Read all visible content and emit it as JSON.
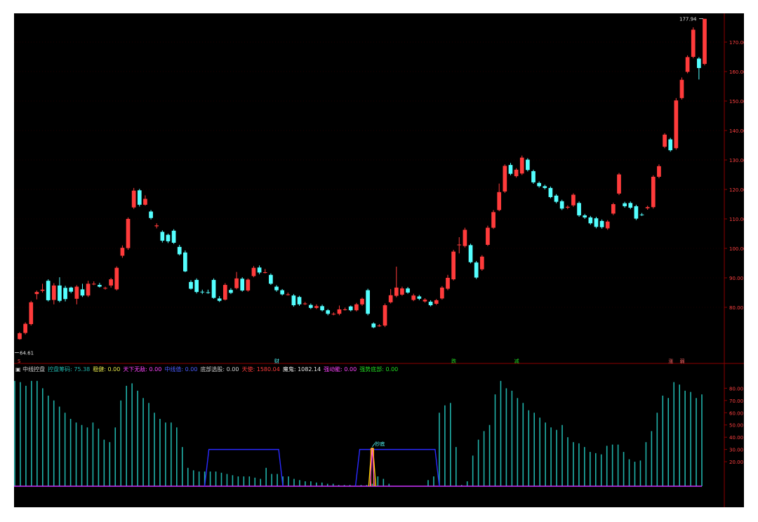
{
  "chart_data": [
    {
      "type": "candlestick",
      "title": "",
      "ylim": [
        54,
        180
      ],
      "yticks": [
        80,
        90,
        100,
        110,
        120,
        130,
        140,
        150,
        160,
        170
      ],
      "ytick_labels": [
        "80.00",
        "90.00",
        "100.00",
        "110.00",
        "120.00",
        "130.00",
        "140.00",
        "150.00",
        "160.00",
        "170.00"
      ],
      "high_label": "177.94",
      "low_label": "64.61",
      "up_color": "#ff3b3b",
      "down_color": "#54ffff",
      "candles": [
        [
          69.2,
          71.2,
          69.0,
          71.6
        ],
        [
          71.3,
          74.4,
          70.8,
          74.9
        ],
        [
          74.3,
          81.7,
          73.8,
          82.2
        ],
        [
          84.5,
          85.2,
          82.7,
          85.7
        ],
        [
          85.6,
          86.0,
          85.0,
          88.0
        ],
        [
          89.0,
          82.4,
          82.0,
          89.5
        ],
        [
          82.5,
          87.4,
          81.0,
          88.2
        ],
        [
          87.4,
          82.2,
          81.7,
          90.2
        ],
        [
          86.6,
          82.8,
          82.0,
          87.3
        ],
        [
          86.7,
          85.3,
          84.8,
          87.0
        ],
        [
          82.9,
          87.0,
          81.0,
          87.5
        ],
        [
          86.1,
          84.0,
          83.5,
          88.0
        ],
        [
          84.0,
          88.0,
          83.5,
          89.0
        ],
        [
          88.0,
          88.0,
          87.5,
          88.8
        ],
        [
          87.6,
          87.0,
          86.7,
          88.3
        ],
        [
          86.5,
          86.6,
          86.0,
          87.0
        ],
        [
          87.4,
          89.5,
          86.7,
          90.0
        ],
        [
          86.1,
          93.4,
          85.7,
          93.9
        ],
        [
          97.5,
          100.2,
          96.8,
          101.0
        ],
        [
          100.1,
          110.0,
          99.5,
          110.5
        ],
        [
          113.9,
          119.6,
          113.4,
          120.5
        ],
        [
          119.7,
          114.8,
          114.2,
          120.2
        ],
        [
          114.8,
          116.8,
          114.5,
          118.0
        ],
        [
          112.5,
          110.3,
          109.8,
          113.0
        ],
        [
          107.5,
          107.8,
          106.8,
          108.5
        ],
        [
          105.6,
          102.6,
          102.0,
          106.1
        ],
        [
          104.6,
          102.4,
          101.8,
          105.0
        ],
        [
          106.0,
          101.9,
          101.5,
          106.5
        ],
        [
          100.5,
          98.0,
          97.6,
          101.2
        ],
        [
          98.6,
          92.2,
          91.9,
          99.3
        ],
        [
          88.6,
          86.3,
          86.0,
          89.2
        ],
        [
          89.3,
          85.2,
          84.7,
          89.8
        ],
        [
          85.3,
          85.1,
          84.5,
          86.0
        ],
        [
          85.1,
          85.0,
          84.6,
          86.0
        ],
        [
          89.3,
          83.2,
          82.9,
          89.8
        ],
        [
          83.0,
          82.2,
          81.8,
          83.8
        ],
        [
          82.6,
          87.6,
          82.3,
          88.2
        ],
        [
          85.9,
          84.9,
          84.5,
          86.5
        ],
        [
          86.5,
          89.8,
          86.1,
          92.0
        ],
        [
          89.7,
          85.7,
          85.3,
          90.2
        ],
        [
          85.7,
          89.4,
          85.3,
          89.8
        ],
        [
          90.6,
          93.4,
          90.2,
          94.0
        ],
        [
          93.5,
          91.8,
          91.2,
          94.2
        ],
        [
          91.9,
          91.9,
          91.5,
          93.0
        ],
        [
          91.0,
          88.0,
          87.6,
          91.5
        ],
        [
          87.0,
          85.8,
          85.3,
          87.5
        ],
        [
          85.8,
          84.4,
          84.0,
          86.2
        ],
        [
          84.4,
          84.4,
          84.0,
          85.0
        ],
        [
          84.0,
          80.7,
          80.2,
          84.5
        ],
        [
          83.5,
          81.0,
          80.5,
          83.9
        ],
        [
          81.3,
          81.3,
          80.8,
          81.8
        ],
        [
          80.8,
          79.8,
          79.4,
          81.3
        ],
        [
          79.8,
          80.4,
          79.4,
          81.0
        ],
        [
          80.4,
          79.0,
          78.6,
          80.9
        ],
        [
          79.0,
          77.8,
          77.3,
          79.4
        ],
        [
          77.8,
          77.8,
          77.3,
          78.3
        ],
        [
          77.8,
          79.3,
          77.3,
          80.6
        ],
        [
          79.3,
          79.3,
          78.9,
          79.9
        ],
        [
          80.3,
          79.0,
          78.6,
          80.6
        ],
        [
          79.0,
          81.0,
          78.6,
          81.5
        ],
        [
          81.0,
          82.9,
          80.5,
          83.3
        ],
        [
          85.8,
          77.8,
          77.3,
          86.3
        ],
        [
          74.5,
          73.2,
          72.9,
          74.9
        ],
        [
          73.8,
          73.8,
          73.4,
          74.3
        ],
        [
          73.8,
          80.7,
          73.3,
          81.3
        ],
        [
          81.7,
          84.1,
          81.3,
          86.2
        ],
        [
          83.9,
          86.7,
          83.4,
          93.8
        ],
        [
          84.3,
          86.4,
          83.9,
          87.0
        ],
        [
          86.4,
          85.0,
          84.6,
          86.9
        ],
        [
          82.5,
          84.0,
          82.1,
          84.6
        ],
        [
          83.7,
          82.9,
          82.4,
          84.2
        ],
        [
          82.0,
          82.6,
          81.6,
          83.1
        ],
        [
          81.9,
          80.7,
          80.3,
          82.4
        ],
        [
          81.2,
          82.4,
          80.8,
          82.8
        ],
        [
          83.0,
          86.7,
          82.6,
          87.2
        ],
        [
          86.3,
          90.0,
          85.8,
          91.0
        ],
        [
          89.5,
          98.9,
          89.1,
          99.5
        ],
        [
          101.3,
          101.3,
          98.3,
          103.8
        ],
        [
          100.8,
          106.3,
          100.3,
          107.0
        ],
        [
          101.1,
          95.3,
          94.9,
          101.6
        ],
        [
          95.2,
          90.1,
          89.6,
          95.7
        ],
        [
          92.9,
          97.2,
          92.4,
          97.7
        ],
        [
          101.2,
          107.0,
          100.8,
          107.7
        ],
        [
          107.0,
          112.3,
          106.6,
          113.0
        ],
        [
          113.0,
          119.1,
          112.6,
          122.0
        ],
        [
          119.3,
          128.0,
          118.8,
          128.5
        ],
        [
          128.3,
          125.3,
          124.8,
          129.0
        ],
        [
          124.5,
          126.7,
          124.0,
          127.2
        ],
        [
          125.4,
          130.8,
          124.9,
          131.5
        ],
        [
          130.1,
          126.6,
          126.1,
          130.6
        ],
        [
          126.2,
          122.4,
          121.9,
          126.7
        ],
        [
          122.2,
          121.1,
          120.6,
          122.7
        ],
        [
          121.1,
          120.5,
          120.0,
          121.6
        ],
        [
          120.5,
          117.4,
          117.0,
          121.0
        ],
        [
          117.9,
          115.8,
          115.3,
          118.4
        ],
        [
          116.0,
          113.5,
          113.0,
          116.5
        ],
        [
          113.8,
          114.1,
          113.3,
          114.6
        ],
        [
          114.6,
          118.2,
          114.1,
          118.7
        ],
        [
          115.4,
          111.2,
          110.7,
          115.9
        ],
        [
          111.2,
          110.5,
          110.0,
          111.7
        ],
        [
          110.5,
          108.5,
          108.0,
          111.0
        ],
        [
          110.2,
          107.3,
          106.8,
          110.7
        ],
        [
          109.3,
          107.2,
          106.7,
          109.8
        ],
        [
          106.8,
          109.1,
          106.3,
          109.6
        ],
        [
          111.8,
          115.0,
          111.3,
          115.5
        ],
        [
          118.6,
          125.1,
          118.1,
          125.6
        ],
        [
          115.3,
          114.3,
          113.8,
          115.8
        ],
        [
          115.4,
          113.8,
          113.3,
          115.9
        ],
        [
          114.3,
          110.1,
          109.6,
          114.8
        ],
        [
          111.5,
          111.4,
          111.0,
          112.0
        ],
        [
          113.6,
          114.0,
          113.1,
          114.5
        ],
        [
          114.0,
          124.3,
          113.5,
          124.8
        ],
        [
          124.3,
          127.9,
          123.8,
          128.5
        ],
        [
          134.5,
          138.6,
          134.0,
          139.1
        ],
        [
          137.0,
          133.3,
          132.8,
          137.5
        ],
        [
          134.0,
          150.2,
          133.5,
          151.0
        ],
        [
          151.0,
          157.2,
          150.5,
          158.0
        ],
        [
          159.9,
          164.9,
          159.4,
          165.5
        ],
        [
          165.0,
          174.2,
          164.5,
          175.0
        ],
        [
          164.4,
          161.2,
          157.3,
          164.9
        ],
        [
          162.6,
          177.9,
          162.1,
          177.9
        ]
      ],
      "markers": [
        {
          "index": 0,
          "label": "S",
          "color": "#ff3b3b"
        },
        {
          "index": 45,
          "label": "财",
          "color": "#54ffff"
        },
        {
          "index": 76,
          "label": "跌",
          "color": "#22dd22"
        },
        {
          "index": 87,
          "label": "减",
          "color": "#22dd22"
        },
        {
          "index": 114,
          "label": "涨",
          "color": "#ff6666"
        },
        {
          "index": 116,
          "label": "弱",
          "color": "#ff6666"
        }
      ]
    },
    {
      "type": "bar",
      "title": "",
      "ylim": [
        0,
        88
      ],
      "yticks": [
        20,
        30,
        40,
        50,
        60,
        70,
        80
      ],
      "ytick_labels": [
        "20.00",
        "30.00",
        "40.00",
        "50.00",
        "60.00",
        "70.00",
        "80.00"
      ],
      "series": [
        {
          "name": "控盘筹码",
          "color": "#20b2aa",
          "values": [
            86,
            85,
            82,
            86,
            86,
            80,
            74,
            70,
            65,
            60,
            55,
            52,
            50,
            48,
            52,
            47,
            38,
            36,
            48,
            70,
            82,
            84,
            78,
            72,
            68,
            60,
            55,
            52,
            52,
            48,
            32,
            15,
            13,
            12,
            12,
            12,
            12,
            11,
            10,
            9,
            8,
            8,
            8,
            7,
            6,
            15,
            10,
            10,
            8,
            8,
            6,
            5,
            4,
            4,
            3,
            3,
            2,
            2,
            1,
            1,
            1,
            1,
            1,
            1,
            1,
            1,
            1,
            1,
            1,
            1,
            1,
            1,
            1,
            1,
            1,
            1,
            1,
            1,
            1,
            1,
            1,
            1,
            1,
            1,
            1,
            1,
            1,
            1,
            1,
            1,
            1,
            1,
            1,
            1,
            1,
            1,
            1,
            1,
            1,
            1,
            1,
            1,
            1,
            1,
            1,
            1,
            1,
            1,
            1,
            1,
            1,
            1,
            1,
            1,
            1,
            1
          ]
        },
        {
          "name": "底部选股",
          "color": "#1a1aff",
          "values": [
            0,
            0,
            0,
            0,
            0,
            0,
            0,
            0,
            0,
            0,
            0,
            0,
            0,
            0,
            0,
            0,
            0,
            0,
            0,
            0,
            0,
            0,
            0,
            0,
            0,
            0,
            0,
            0,
            0,
            0,
            0,
            0,
            0,
            0,
            0,
            0,
            0,
            0,
            0,
            0,
            0,
            0,
            0,
            0,
            0,
            0,
            0,
            0,
            0,
            0,
            0,
            0,
            0,
            0,
            0,
            0,
            0,
            0,
            0,
            0,
            0,
            0,
            0,
            0,
            0,
            0,
            0,
            0,
            0,
            0,
            0,
            0,
            0,
            0,
            0,
            0,
            0,
            0,
            0,
            0,
            0,
            0,
            0,
            0,
            0,
            0,
            0,
            0,
            0,
            0,
            0,
            0,
            0,
            0,
            0,
            0,
            0,
            0,
            0,
            0,
            0,
            0,
            0,
            0,
            0,
            0,
            0,
            0,
            0,
            0,
            0,
            0,
            0,
            0,
            0,
            0
          ]
        }
      ],
      "bars": [
        86,
        85,
        82,
        86,
        86,
        80,
        74,
        70,
        65,
        60,
        55,
        52,
        50,
        48,
        52,
        47,
        38,
        36,
        48,
        70,
        82,
        84,
        78,
        72,
        68,
        60,
        55,
        52,
        52,
        48,
        32,
        15,
        13,
        12,
        12,
        12,
        12,
        11,
        10,
        9,
        8,
        8,
        8,
        7,
        6,
        15,
        10,
        10,
        8,
        8,
        6,
        5,
        4,
        4,
        3,
        3,
        2,
        2,
        1,
        1,
        1,
        1,
        1,
        1,
        2,
        8,
        6,
        2,
        0,
        0,
        0,
        0,
        0,
        0,
        5,
        8,
        60,
        66,
        68,
        32,
        1,
        4,
        25,
        38,
        45,
        50,
        75,
        86,
        80,
        78,
        72,
        68,
        62,
        60,
        56,
        52,
        48,
        46,
        50,
        40,
        36,
        35,
        32,
        28,
        27,
        26,
        33,
        34,
        34,
        28,
        22,
        20,
        21,
        36,
        45,
        60,
        74,
        72,
        85,
        83,
        78,
        77,
        72,
        75
      ],
      "band_a_high": 30,
      "band_segments": [
        [
          34,
          48
        ],
        [
          61,
          76
        ]
      ],
      "pulse_label": "抄底",
      "pulse_index": 64
    }
  ],
  "indicator_legend": {
    "name": "中线控盘",
    "items": [
      {
        "label": "控盘筹码",
        "value": "75.38",
        "color": "#20b2aa"
      },
      {
        "label": "稳健",
        "value": "0.00",
        "color": "#e6e64a"
      },
      {
        "label": "天下无敌",
        "value": "0.00",
        "color": "#ff44ff"
      },
      {
        "label": "中线值",
        "value": "0.00",
        "color": "#4a5cff"
      },
      {
        "label": "底部选股",
        "value": "0.00",
        "color": "#d0d0d0"
      },
      {
        "label": "天使",
        "value": "1580.04",
        "color": "#ff3b3b"
      },
      {
        "label": "魔鬼",
        "value": "1082.14",
        "color": "#e8e8e8"
      },
      {
        "label": "强动能",
        "value": "0.00",
        "color": "#ff44ff"
      },
      {
        "label": "强势底部",
        "value": "0.00",
        "color": "#22dd22"
      }
    ]
  }
}
